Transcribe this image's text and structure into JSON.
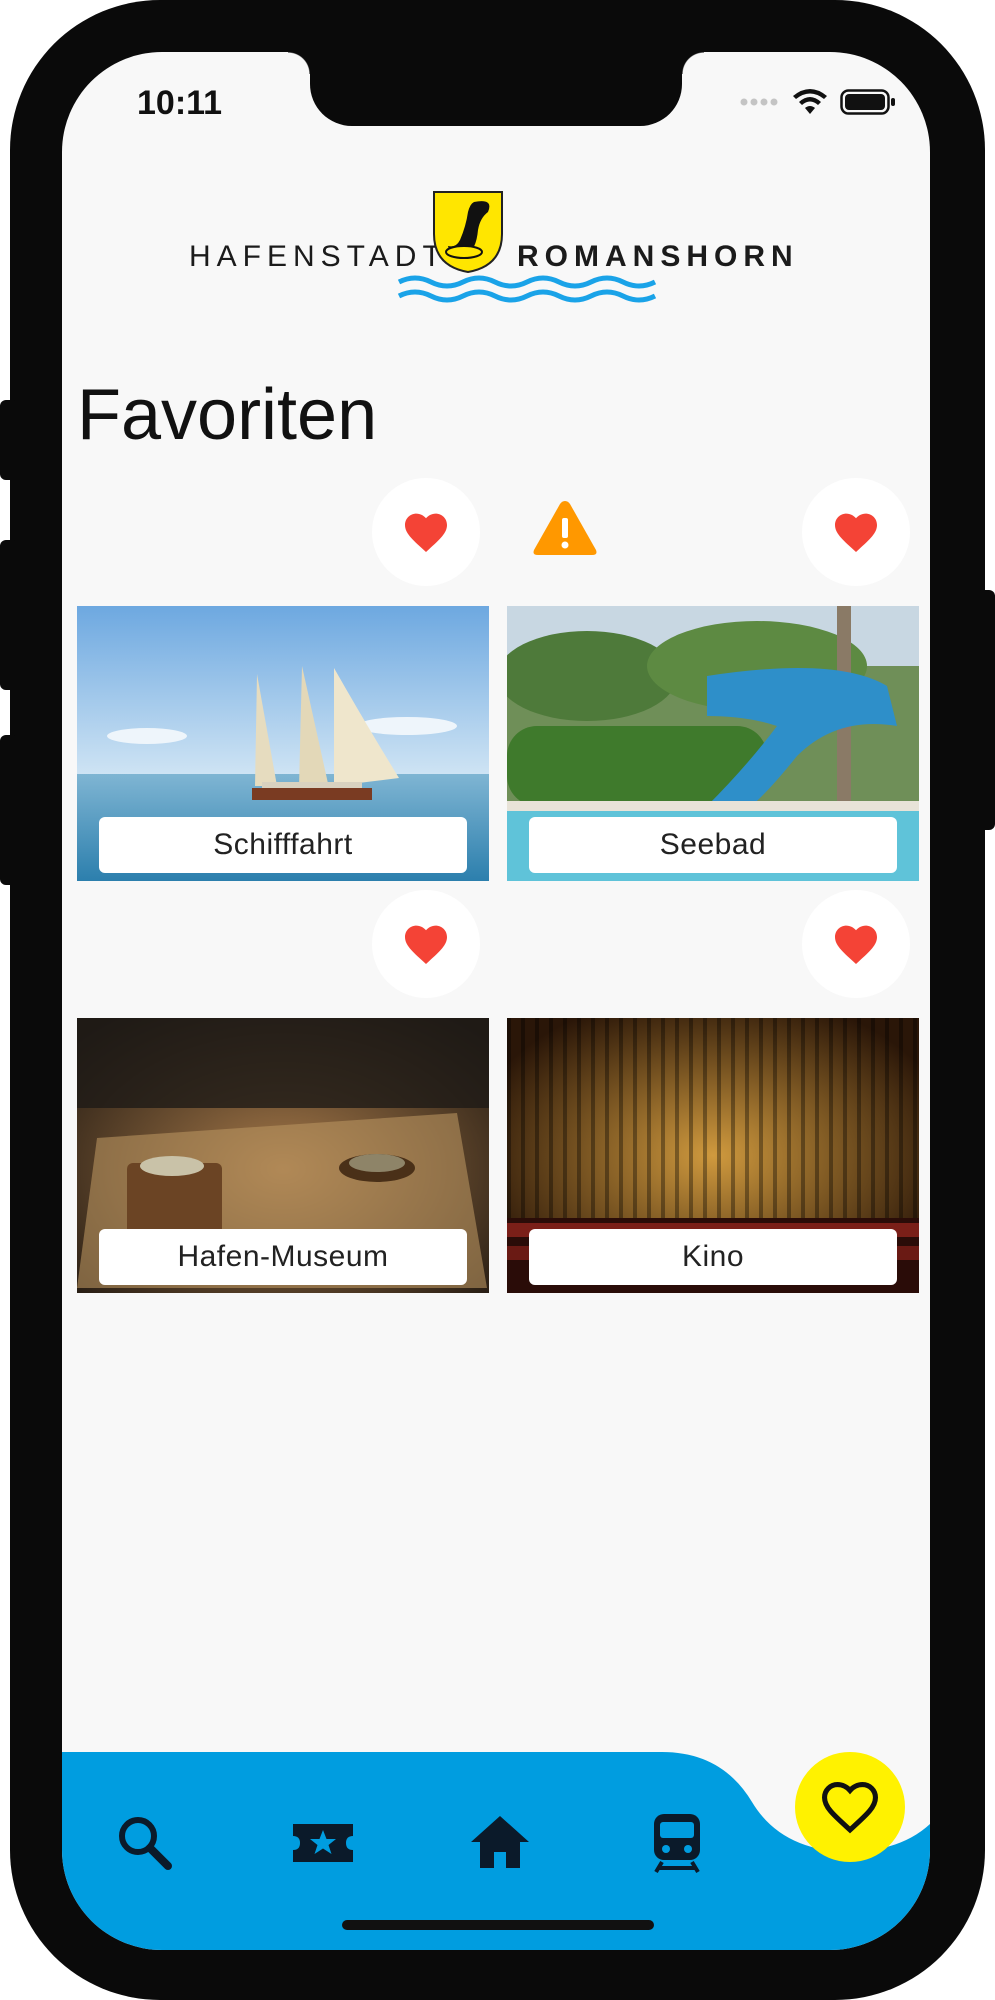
{
  "status_bar": {
    "time": "10:11"
  },
  "logo": {
    "left_text": "HAFENSTADT",
    "right_text": "ROMANSHORN"
  },
  "page": {
    "title": "Favoriten"
  },
  "favorites": [
    {
      "label": "Schifffahrt",
      "favorited": true
    },
    {
      "label": "Seebad",
      "favorited": true
    },
    {
      "label": "Hafen-Museum",
      "favorited": true
    },
    {
      "label": "Kino",
      "favorited": true
    }
  ],
  "bottom_nav": {
    "items": [
      "search-icon",
      "ticket-star-icon",
      "home-icon",
      "train-icon"
    ],
    "active": "heart-outline-icon"
  },
  "colors": {
    "accent_blue": "#009de0",
    "fab_yellow": "#fff200",
    "heart_red": "#f44336",
    "warning_orange": "#ff9800"
  }
}
